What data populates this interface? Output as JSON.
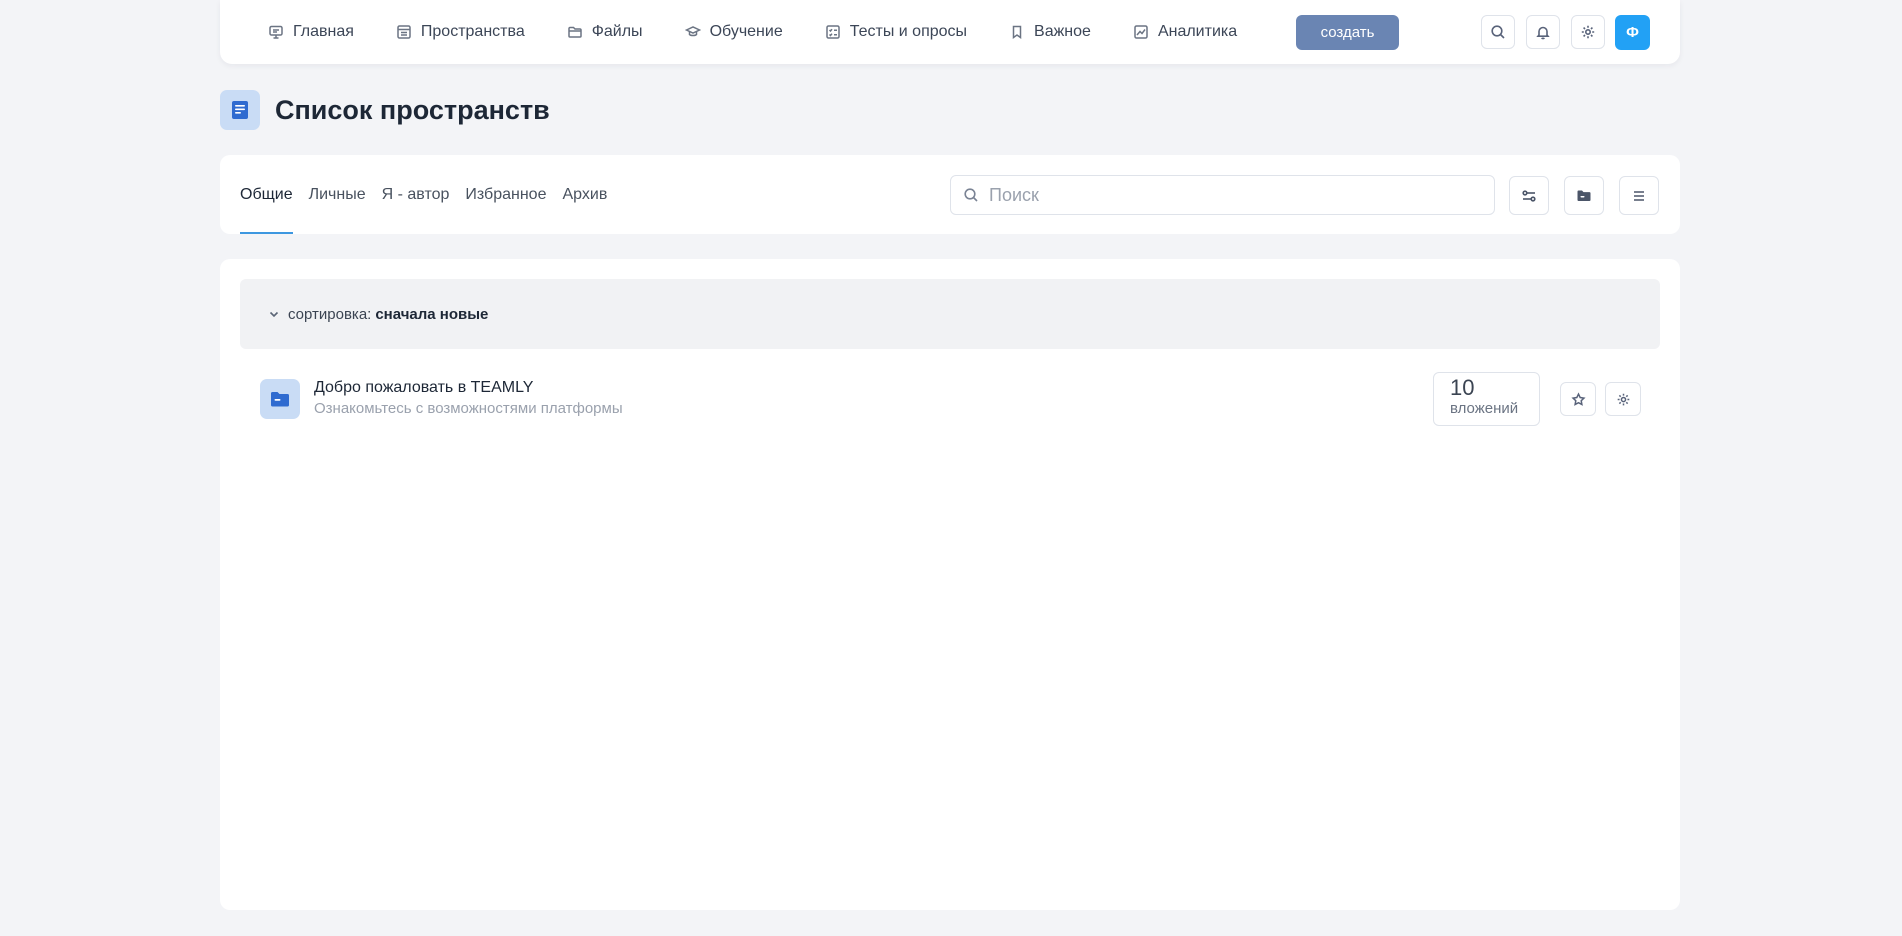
{
  "nav": {
    "items": [
      {
        "label": "Главная",
        "icon": "monitor-icon"
      },
      {
        "label": "Пространства",
        "icon": "spaces-icon"
      },
      {
        "label": "Файлы",
        "icon": "folder-icon"
      },
      {
        "label": "Обучение",
        "icon": "graduation-cap-icon"
      },
      {
        "label": "Тесты и опросы",
        "icon": "checklist-icon"
      },
      {
        "label": "Важное",
        "icon": "bookmark-icon"
      },
      {
        "label": "Аналитика",
        "icon": "chart-icon"
      }
    ],
    "create_label": "создать",
    "avatar_letter": "Ф"
  },
  "colors": {
    "accent": "#3d97e0",
    "create_button": "#6a85b3",
    "avatar": "#22a1f5",
    "icon_bg": "#c9dcf5",
    "icon_fg": "#2f6bd0"
  },
  "page": {
    "title": "Список пространств"
  },
  "tabs": [
    "Общие",
    "Личные",
    "Я - автор",
    "Избранное",
    "Архив"
  ],
  "active_tab": "Общие",
  "search": {
    "placeholder": "Поиск"
  },
  "sort": {
    "label": "сортировка:",
    "value": "сначала новые"
  },
  "spaces": [
    {
      "title": "Добро пожаловать в TEAMLY",
      "description": "Ознакомьтесь с возможностями платформы",
      "count": "10",
      "count_label": "вложений"
    }
  ]
}
